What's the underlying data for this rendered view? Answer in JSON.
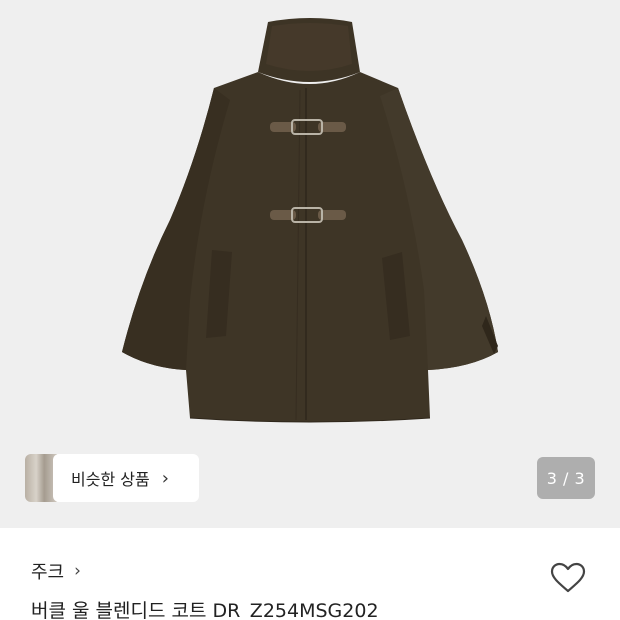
{
  "gallery": {
    "image_alt": "버클 울 블렌디드 코트",
    "similar_products": {
      "label": "비슷한 상품",
      "chevron_icon": "chevron-right-icon"
    },
    "page_indicator": "3 / 3",
    "colors": {
      "background": "#efefef",
      "coat": "#3e3526"
    }
  },
  "product": {
    "brand": "주크",
    "brand_chevron_icon": "chevron-right-icon",
    "name": "버클 울 블렌디드 코트 DR_Z254MSG202",
    "wishlist_icon": "heart-outline-icon"
  }
}
